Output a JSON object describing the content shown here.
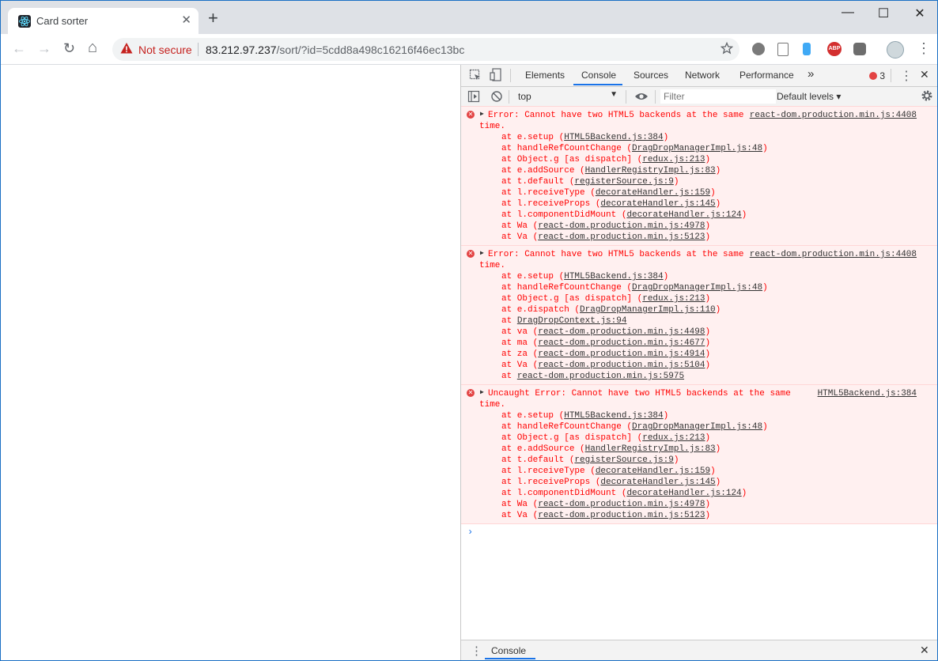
{
  "browser": {
    "tab_title": "Card sorter",
    "new_tab_symbol": "+",
    "close_symbol": "✕",
    "window_controls": {
      "minimize": "—",
      "maximize": "☐",
      "close": "✕"
    },
    "nav": {
      "back": "←",
      "forward": "→",
      "reload": "↻",
      "home": "⌂"
    },
    "security_label": "Not secure",
    "url_host": "83.212.97.237",
    "url_path": "/sort/?id=5cdd8a498c16216f46ec13bc",
    "bookmark_icon": "star-icon",
    "menu_symbol": "⋮"
  },
  "devtools": {
    "tabs": [
      "Elements",
      "Console",
      "Sources",
      "Network",
      "Performance"
    ],
    "active_tab": "Console",
    "more_tabs_symbol": "»",
    "error_count": "3",
    "context": "top",
    "filter_placeholder": "Filter",
    "levels_label": "Default levels ▾",
    "drawer_tab": "Console"
  },
  "console_entries": [
    {
      "message_line1": "Error: Cannot have two HTML5 backends at the same",
      "message_line2": "time.",
      "source": "react-dom.production.min.js:4408",
      "frames": [
        {
          "pre": "at e.setup (",
          "link": "HTML5Backend.js:384",
          "post": ")"
        },
        {
          "pre": "at handleRefCountChange (",
          "link": "DragDropManagerImpl.js:48",
          "post": ")"
        },
        {
          "pre": "at Object.g [as dispatch] (",
          "link": "redux.js:213",
          "post": ")"
        },
        {
          "pre": "at e.addSource (",
          "link": "HandlerRegistryImpl.js:83",
          "post": ")"
        },
        {
          "pre": "at t.default (",
          "link": "registerSource.js:9",
          "post": ")"
        },
        {
          "pre": "at l.receiveType (",
          "link": "decorateHandler.js:159",
          "post": ")"
        },
        {
          "pre": "at l.receiveProps (",
          "link": "decorateHandler.js:145",
          "post": ")"
        },
        {
          "pre": "at l.componentDidMount (",
          "link": "decorateHandler.js:124",
          "post": ")"
        },
        {
          "pre": "at Wa (",
          "link": "react-dom.production.min.js:4978",
          "post": ")"
        },
        {
          "pre": "at Va (",
          "link": "react-dom.production.min.js:5123",
          "post": ")"
        }
      ]
    },
    {
      "message_line1": "Error: Cannot have two HTML5 backends at the same",
      "message_line2": "time.",
      "source": "react-dom.production.min.js:4408",
      "frames": [
        {
          "pre": "at e.setup (",
          "link": "HTML5Backend.js:384",
          "post": ")"
        },
        {
          "pre": "at handleRefCountChange (",
          "link": "DragDropManagerImpl.js:48",
          "post": ")"
        },
        {
          "pre": "at Object.g [as dispatch] (",
          "link": "redux.js:213",
          "post": ")"
        },
        {
          "pre": "at e.dispatch (",
          "link": "DragDropManagerImpl.js:110",
          "post": ")"
        },
        {
          "pre": "at ",
          "link": "DragDropContext.js:94",
          "post": ""
        },
        {
          "pre": "at va (",
          "link": "react-dom.production.min.js:4498",
          "post": ")"
        },
        {
          "pre": "at ma (",
          "link": "react-dom.production.min.js:4677",
          "post": ")"
        },
        {
          "pre": "at za (",
          "link": "react-dom.production.min.js:4914",
          "post": ")"
        },
        {
          "pre": "at Va (",
          "link": "react-dom.production.min.js:5104",
          "post": ")"
        },
        {
          "pre": "at ",
          "link": "react-dom.production.min.js:5975",
          "post": ""
        }
      ]
    },
    {
      "message_line1": "Uncaught Error: Cannot have two HTML5 backends at the same",
      "message_line2": "time.",
      "source": "HTML5Backend.js:384",
      "frames": [
        {
          "pre": "at e.setup (",
          "link": "HTML5Backend.js:384",
          "post": ")"
        },
        {
          "pre": "at handleRefCountChange (",
          "link": "DragDropManagerImpl.js:48",
          "post": ")"
        },
        {
          "pre": "at Object.g [as dispatch] (",
          "link": "redux.js:213",
          "post": ")"
        },
        {
          "pre": "at e.addSource (",
          "link": "HandlerRegistryImpl.js:83",
          "post": ")"
        },
        {
          "pre": "at t.default (",
          "link": "registerSource.js:9",
          "post": ")"
        },
        {
          "pre": "at l.receiveType (",
          "link": "decorateHandler.js:159",
          "post": ")"
        },
        {
          "pre": "at l.receiveProps (",
          "link": "decorateHandler.js:145",
          "post": ")"
        },
        {
          "pre": "at l.componentDidMount (",
          "link": "decorateHandler.js:124",
          "post": ")"
        },
        {
          "pre": "at Wa (",
          "link": "react-dom.production.min.js:4978",
          "post": ")"
        },
        {
          "pre": "at Va (",
          "link": "react-dom.production.min.js:5123",
          "post": ")"
        }
      ]
    }
  ],
  "prompt_symbol": "›",
  "colors": {
    "error_text": "#ff0000",
    "error_bg": "#fff0f0",
    "accent": "#1a73e8",
    "not_secure": "#c5221f"
  }
}
